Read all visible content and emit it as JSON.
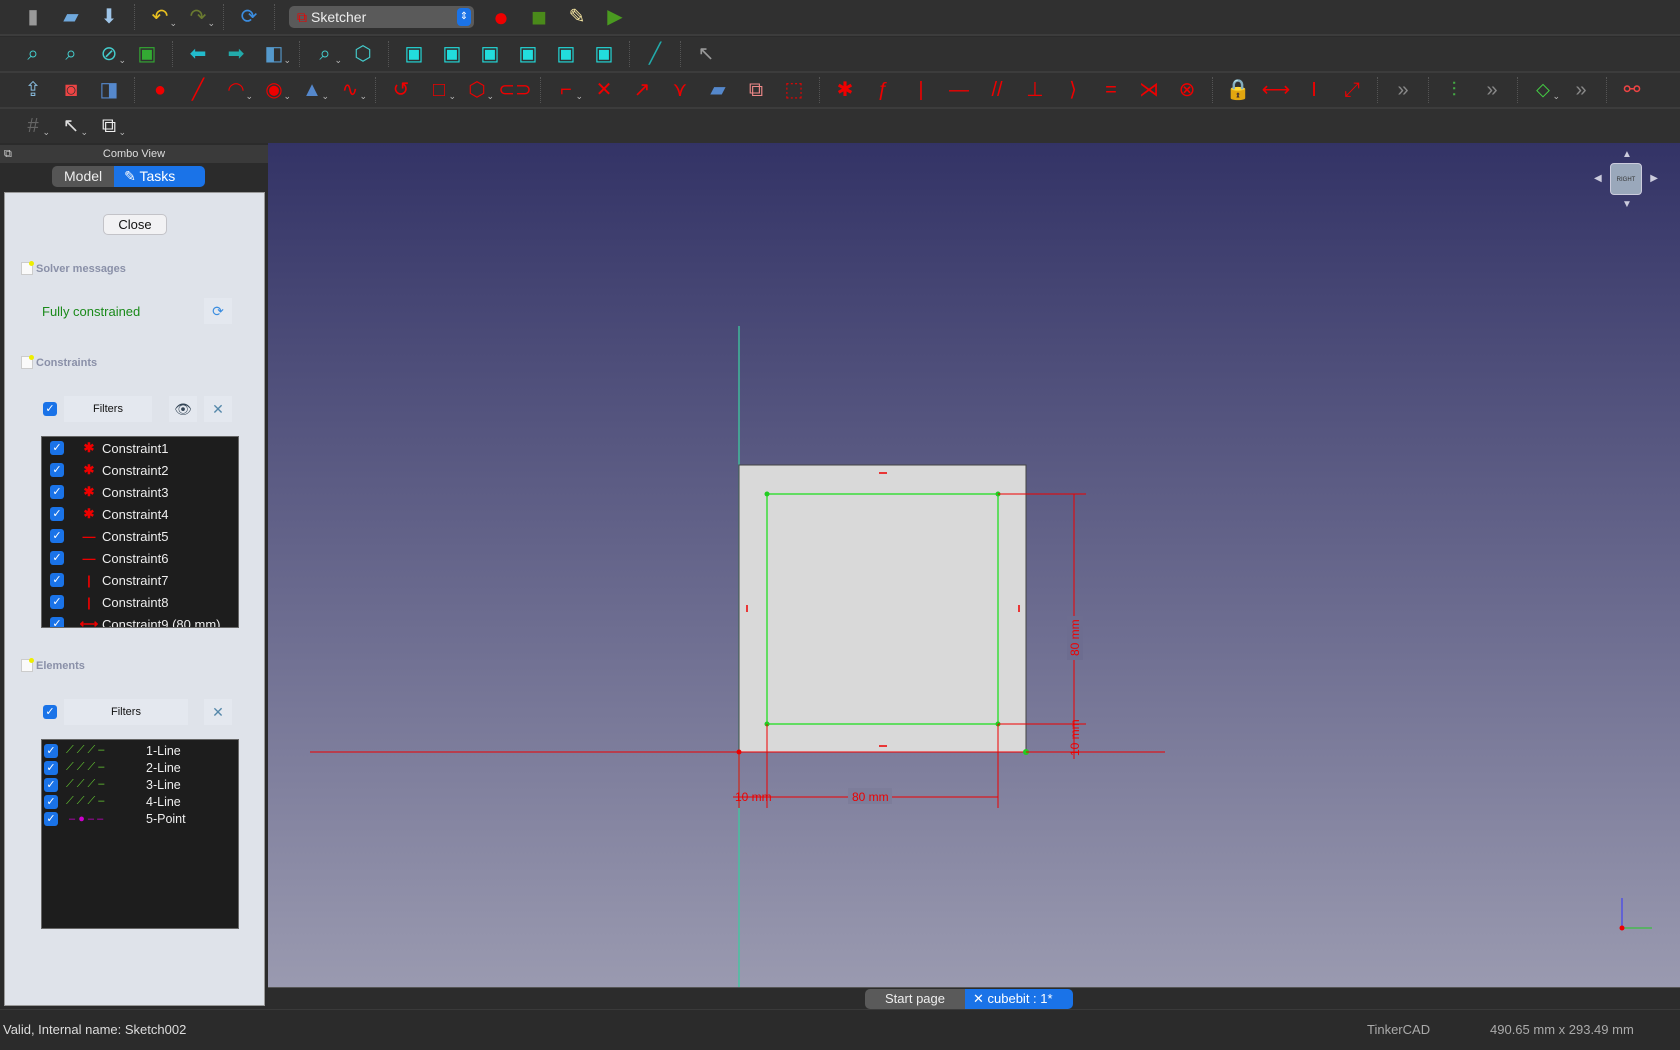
{
  "toolbar": {
    "row1": [
      "new-file",
      "open-folder",
      "save",
      "undo",
      "redo",
      "refresh"
    ],
    "workbench": "Sketcher",
    "row1b": [
      "record-macro",
      "stop-macro",
      "edit-macro",
      "run-macro"
    ],
    "row2": [
      "fit-all",
      "fit-selection",
      "draw-style",
      "bounding-box",
      "back-arrow",
      "forward-arrow",
      "std-views",
      "zoom",
      "isometric",
      "front-view",
      "top-view",
      "right-view",
      "rear-view",
      "bottom-view",
      "left-view",
      "measure",
      "whats-this"
    ],
    "row3": [
      "leave-sketch",
      "view-sketch",
      "view-section",
      "point",
      "line",
      "arc",
      "circle",
      "conic",
      "bspline",
      "polyline",
      "rectangle",
      "polygon",
      "slot",
      "fillet",
      "trim",
      "extend",
      "split",
      "external-geometry",
      "carbon-copy",
      "construction-mode",
      "constrain-coincident",
      "constrain-point-on-object",
      "constrain-vertical",
      "constrain-horizontal",
      "constrain-parallel",
      "constrain-perpendicular",
      "constrain-tangent",
      "constrain-equal",
      "constrain-symmetric",
      "constrain-block",
      "constrain-lock",
      "constrain-horizontal-distance",
      "constrain-vertical-distance",
      "constrain-distance",
      "more-a",
      "toggle-driving",
      "more-b",
      "select-elements",
      "more-c",
      "sketch-settings"
    ],
    "row4": [
      "grid",
      "snap",
      "rendering-order"
    ]
  },
  "combo": {
    "title": "Combo View",
    "tabs": [
      {
        "label": "Model",
        "active": false
      },
      {
        "label": "Tasks",
        "active": true
      }
    ]
  },
  "tasks": {
    "close": "Close",
    "solver_title": "Solver messages",
    "solver_status": "Fully constrained",
    "constraints_title": "Constraints",
    "filters": "Filters",
    "constraints": [
      {
        "name": "Constraint1",
        "type": "coincident"
      },
      {
        "name": "Constraint2",
        "type": "coincident"
      },
      {
        "name": "Constraint3",
        "type": "coincident"
      },
      {
        "name": "Constraint4",
        "type": "coincident"
      },
      {
        "name": "Constraint5",
        "type": "horizontal"
      },
      {
        "name": "Constraint6",
        "type": "horizontal"
      },
      {
        "name": "Constraint7",
        "type": "vertical"
      },
      {
        "name": "Constraint8",
        "type": "vertical"
      },
      {
        "name": "Constraint9 (80 mm)",
        "type": "distance-x"
      }
    ],
    "elements_title": "Elements",
    "elements": [
      "1-Line",
      "2-Line",
      "3-Line",
      "4-Line",
      "5-Point"
    ]
  },
  "viewport": {
    "dims": {
      "width": "80 mm",
      "height": "80 mm",
      "offset_x": "10 mm",
      "offset_y": "10 mm"
    },
    "navcube_face": "RIGHT",
    "colors": {
      "sketch": "#22dd22",
      "constraint": "#e00000",
      "face": "#d9d9d9"
    }
  },
  "doc_tabs": [
    {
      "label": "Start page",
      "active": false
    },
    {
      "label": "cubebit : 1*",
      "active": true
    }
  ],
  "status": {
    "message": "Valid, Internal name: Sketch002",
    "nav_style": "TinkerCAD",
    "dimensions": "490.65 mm x 293.49 mm"
  }
}
